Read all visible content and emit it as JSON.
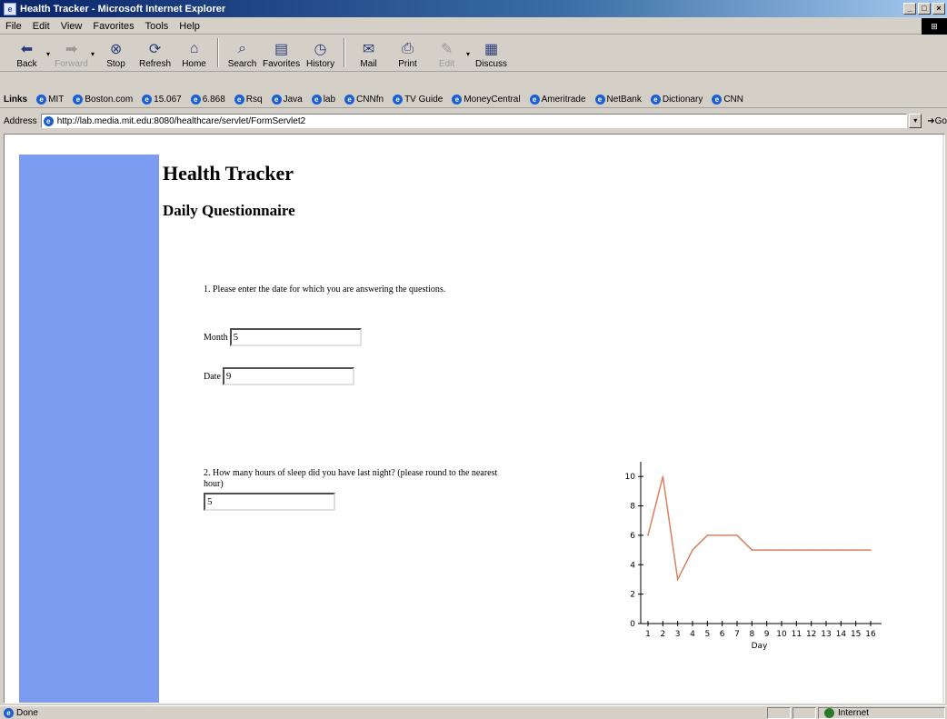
{
  "window": {
    "title": "Health Tracker - Microsoft Internet Explorer"
  },
  "menu": [
    "File",
    "Edit",
    "View",
    "Favorites",
    "Tools",
    "Help"
  ],
  "toolbar": {
    "back": "Back",
    "forward": "Forward",
    "stop": "Stop",
    "refresh": "Refresh",
    "home": "Home",
    "search": "Search",
    "favorites": "Favorites",
    "history": "History",
    "mail": "Mail",
    "print": "Print",
    "edit": "Edit",
    "discuss": "Discuss"
  },
  "links": {
    "label": "Links",
    "items": [
      "MIT",
      "Boston.com",
      "15.067",
      "6.868",
      "Rsq",
      "Java",
      "lab",
      "CNNfn",
      "TV Guide",
      "MoneyCentral",
      "Ameritrade",
      "NetBank",
      "Dictionary",
      "CNN"
    ]
  },
  "address": {
    "label": "Address",
    "url": "http://lab.media.mit.edu:8080/healthcare/servlet/FormServlet2",
    "go": "Go"
  },
  "page": {
    "title": "Health Tracker",
    "subtitle": "Daily Questionnaire",
    "q1": "1. Please enter the date for which you are answering the questions.",
    "month_label": "Month",
    "month_value": "5",
    "date_label": "Date",
    "date_value": "9",
    "q2": "2. How many hours of sleep did you have last night? (please round to the nearest hour)",
    "sleep_value": "5"
  },
  "chart_data": {
    "type": "line",
    "xlabel": "Day",
    "ylabel": "",
    "x": [
      1,
      2,
      3,
      4,
      5,
      6,
      7,
      8,
      9,
      10,
      11,
      12,
      13,
      14,
      15,
      16
    ],
    "y": [
      6,
      10,
      3,
      5,
      6,
      6,
      6,
      5,
      5,
      5,
      5,
      5,
      5,
      5,
      5,
      5
    ],
    "y_ticks": [
      0,
      2,
      4,
      6,
      8,
      10
    ],
    "ylim": [
      0,
      11
    ],
    "xlim": [
      1,
      16
    ],
    "line_color": "#d98060"
  },
  "status": {
    "text": "Done",
    "zone": "Internet"
  },
  "colors": {
    "sidebar": "#7b9cf0"
  }
}
